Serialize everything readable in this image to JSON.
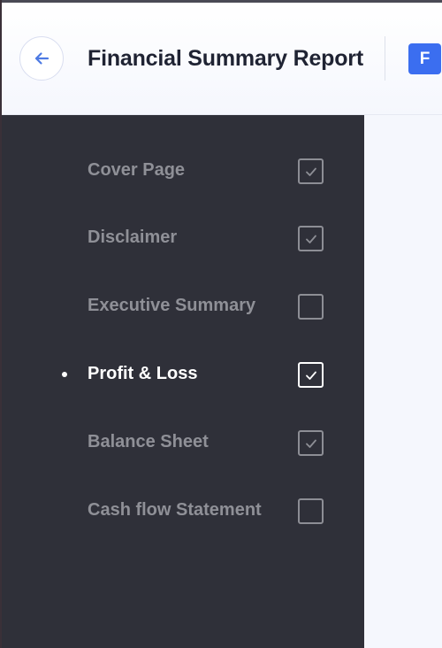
{
  "header": {
    "title": "Financial Summary Report",
    "avatar_initial": "F",
    "back_icon": "arrow-left-icon"
  },
  "colors": {
    "sidebar_bg": "#2f3039",
    "accent": "#3b6ef0",
    "inactive_text": "#8f9097",
    "active_text": "#ffffff"
  },
  "sidebar": {
    "items": [
      {
        "label": "Cover Page",
        "checked": true,
        "active": false
      },
      {
        "label": "Disclaimer",
        "checked": true,
        "active": false
      },
      {
        "label": "Executive Summary",
        "checked": false,
        "active": false
      },
      {
        "label": "Profit & Loss",
        "checked": true,
        "active": true
      },
      {
        "label": "Balance Sheet",
        "checked": true,
        "active": false
      },
      {
        "label": "Cash flow Statement",
        "checked": false,
        "active": false
      }
    ]
  }
}
